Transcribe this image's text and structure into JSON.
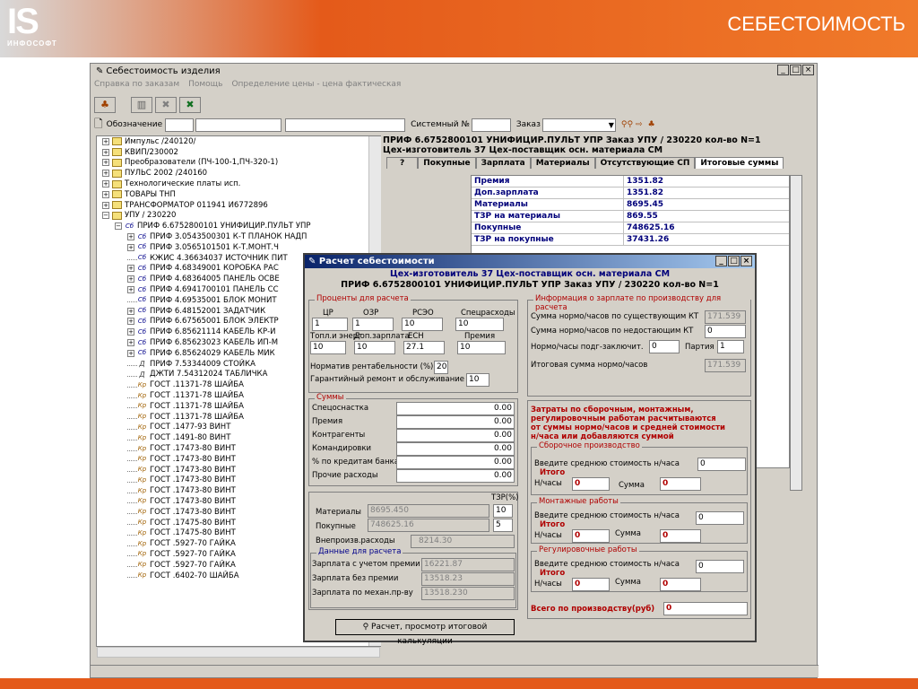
{
  "slide": {
    "logo_big": "IS",
    "logo_small": "ИНФОСОФТ",
    "title": "СЕБЕСТОИМОСТЬ"
  },
  "app": {
    "title": "Себестоимость изделия",
    "menu": [
      "Справка по заказам",
      "Помощь",
      "Определение цены - цена фактическая"
    ],
    "filter": {
      "designation_label": "Обозначение",
      "system_label": "Системный №",
      "order_label": "Заказ"
    }
  },
  "tree": [
    {
      "t": "Импульс /240120/",
      "lv": 1,
      "k": "f"
    },
    {
      "t": "КВИП/230002",
      "lv": 1,
      "k": "f"
    },
    {
      "t": "Преобразователи (ПЧ-100-1,ПЧ-320-1)",
      "lv": 1,
      "k": "f"
    },
    {
      "t": "ПУЛЬС 2002 /240160",
      "lv": 1,
      "k": "f"
    },
    {
      "t": "Технологические платы исп.",
      "lv": 1,
      "k": "f"
    },
    {
      "t": "ТОВАРЫ ТНП",
      "lv": 1,
      "k": "f"
    },
    {
      "t": "ТРАНСФОРМАТОР 011941 И6772896",
      "lv": 1,
      "k": "f"
    },
    {
      "t": "УПУ  / 230220",
      "lv": 1,
      "k": "f",
      "open": true
    },
    {
      "t": "ПРИФ 6.6752800101  УНИФИЦИР.ПУЛЬТ УПР",
      "lv": 2,
      "k": "c",
      "open": true
    },
    {
      "t": "ПРИФ 3.0543500301  К-Т ПЛАНОК НАДП",
      "lv": 3,
      "k": "c"
    },
    {
      "t": "ПРИФ 3.0565101501  К-Т.МОНТ.Ч",
      "lv": 3,
      "k": "c"
    },
    {
      "t": "КЖИС 4.36634037  ИСТОЧНИК ПИТ",
      "lv": 3,
      "k": "c",
      "leaf": true
    },
    {
      "t": "ПРИФ 4.68349001  КОРОБКА РАС",
      "lv": 3,
      "k": "c"
    },
    {
      "t": "ПРИФ 4.68364005  ПАНЕЛЬ ОСВЕ",
      "lv": 3,
      "k": "c"
    },
    {
      "t": "ПРИФ 4.6941700101  ПАНЕЛЬ СС",
      "lv": 3,
      "k": "c"
    },
    {
      "t": "ПРИФ 4.69535001  БЛОК МОНИТ",
      "lv": 3,
      "k": "c",
      "leaf": true
    },
    {
      "t": "ПРИФ 6.48152001  ЗАДАТЧИК",
      "lv": 3,
      "k": "c"
    },
    {
      "t": "ПРИФ 6.67565001  БЛОК ЭЛЕКТР",
      "lv": 3,
      "k": "c"
    },
    {
      "t": "ПРИФ 6.85621114  КАБЕЛЬ КР-И",
      "lv": 3,
      "k": "c"
    },
    {
      "t": "ПРИФ 6.85623023  КАБЕЛЬ ИП-М",
      "lv": 3,
      "k": "c"
    },
    {
      "t": "ПРИФ 6.85624029  КАБЕЛЬ МИК",
      "lv": 3,
      "k": "c"
    },
    {
      "t": "ПРИФ 7.53344009  СТОЙКА",
      "lv": 3,
      "k": "d",
      "leaf": true
    },
    {
      "t": "ДЖТИ 7.54312024  ТАБЛИЧКА",
      "lv": 3,
      "k": "d",
      "leaf": true
    },
    {
      "t": "ГОСТ .11371-78  ШАЙБА",
      "lv": 3,
      "k": "p",
      "leaf": true
    },
    {
      "t": "ГОСТ .11371-78  ШАЙБА",
      "lv": 3,
      "k": "p",
      "leaf": true
    },
    {
      "t": "ГОСТ .11371-78  ШАЙБА",
      "lv": 3,
      "k": "p",
      "leaf": true
    },
    {
      "t": "ГОСТ .11371-78  ШАЙБА",
      "lv": 3,
      "k": "p",
      "leaf": true
    },
    {
      "t": "ГОСТ .1477-93  ВИНТ",
      "lv": 3,
      "k": "p",
      "leaf": true
    },
    {
      "t": "ГОСТ .1491-80  ВИНТ",
      "lv": 3,
      "k": "p",
      "leaf": true
    },
    {
      "t": "ГОСТ .17473-80  ВИНТ",
      "lv": 3,
      "k": "p",
      "leaf": true
    },
    {
      "t": "ГОСТ .17473-80  ВИНТ",
      "lv": 3,
      "k": "p",
      "leaf": true
    },
    {
      "t": "ГОСТ .17473-80  ВИНТ",
      "lv": 3,
      "k": "p",
      "leaf": true
    },
    {
      "t": "ГОСТ .17473-80  ВИНТ",
      "lv": 3,
      "k": "p",
      "leaf": true
    },
    {
      "t": "ГОСТ .17473-80  ВИНТ",
      "lv": 3,
      "k": "p",
      "leaf": true
    },
    {
      "t": "ГОСТ .17473-80  ВИНТ",
      "lv": 3,
      "k": "p",
      "leaf": true
    },
    {
      "t": "ГОСТ .17473-80  ВИНТ",
      "lv": 3,
      "k": "p",
      "leaf": true
    },
    {
      "t": "ГОСТ .17475-80  ВИНТ",
      "lv": 3,
      "k": "p",
      "leaf": true
    },
    {
      "t": "ГОСТ .17475-80  ВИНТ",
      "lv": 3,
      "k": "p",
      "leaf": true
    },
    {
      "t": "ГОСТ .5927-70  ГАЙКА",
      "lv": 3,
      "k": "p",
      "leaf": true
    },
    {
      "t": "ГОСТ .5927-70  ГАЙКА",
      "lv": 3,
      "k": "p",
      "leaf": true
    },
    {
      "t": "ГОСТ .5927-70  ГАЙКА",
      "lv": 3,
      "k": "p",
      "leaf": true
    },
    {
      "t": "ГОСТ .6402-70  ШАЙБА",
      "lv": 3,
      "k": "p",
      "leaf": true
    }
  ],
  "right": {
    "line1": "ПРИФ 6.6752800101  УНИФИЦИР.ПУЛЬТ УПР      Заказ УПУ  / 230220  кол-во N=1",
    "line2": "Цех-изготовитель 37  Цех-поставщик осн. материала СМ",
    "tabs": [
      "?",
      "Покупные",
      "Зарплата",
      "Материалы",
      "Отсутствующие СП",
      "Итоговые суммы"
    ],
    "rows": [
      [
        "Премия",
        "1351.82"
      ],
      [
        "Доп.зарплата",
        "1351.82"
      ],
      [
        "Материалы",
        "8695.45"
      ],
      [
        "ТЗР на материалы",
        "869.55"
      ],
      [
        "Покупные",
        "748625.16"
      ],
      [
        "ТЗР на покупные",
        "37431.26"
      ]
    ]
  },
  "dialog": {
    "title": "Расчет себестоимости",
    "line1": "Цех-изготовитель 37  Цех-поставщик осн. материала СМ",
    "line2": "ПРИФ 6.6752800101  УНИФИЦИР.ПУЛЬТ УПР      Заказ УПУ  / 230220  кол-во N=1",
    "pct": {
      "title": "Проценты для расчета",
      "h1": [
        "ЦР",
        "ОЗР",
        "РСЭО",
        "Спецрасходы"
      ],
      "v1": [
        "1",
        "1",
        "10",
        "10"
      ],
      "h2": [
        "Топл.и энерг",
        "Доп.зарплата",
        "ЕСН",
        "Премия"
      ],
      "v2": [
        "10",
        "10",
        "27.1",
        "10"
      ],
      "rent_label": "Норматив рентабельности (%)",
      "rent": "20",
      "gar_label": "Гарантийный ремонт и обслуживание",
      "gar": "10"
    },
    "sums": {
      "title": "Суммы",
      "rows": [
        [
          "Спецоснастка",
          "0.00"
        ],
        [
          "Премия",
          "0.00"
        ],
        [
          "Контрагенты",
          "0.00"
        ],
        [
          "Командировки",
          "0.00"
        ],
        [
          "% по кредитам банка",
          "0.00"
        ],
        [
          "Прочие расходы",
          "0.00"
        ]
      ]
    },
    "mat": {
      "tzr_label": "ТЗР(%)",
      "rows": [
        [
          "Материалы",
          "8695.450",
          "10"
        ],
        [
          "Покупные",
          "748625.16",
          "5"
        ]
      ],
      "vnepr_label": "Внепроизв.расходы",
      "vnepr": "8214.30"
    },
    "calc": {
      "title": "Данные для расчета",
      "rows": [
        [
          "Зарплата с учетом премии",
          "16221.87"
        ],
        [
          "Зарплата без премии",
          "13518.23"
        ],
        [
          "Зарплата по механ.пр-ву",
          "13518.230"
        ]
      ]
    },
    "info": {
      "title": "Информация о зарплате по производству для расчета",
      "r1": "Сумма нормо/часов  по существующим КТ",
      "v1": "171.539",
      "r2": "Сумма нормо/часов  по недостающим КТ",
      "v2": "0",
      "r3": "Нормо/часы подг-заключит.",
      "v3": "0",
      "party_label": "Партия",
      "party": "1",
      "r4": "Итоговая сумма нормо/часов",
      "v4": "171.539"
    },
    "costs_text": [
      "Затраты  по сборочным, монтажным,",
      "регулировочным работам  расчитываются",
      " от суммы нормо/часов  и средней стоимости",
      "н/часа или добавляются суммой"
    ],
    "asm": {
      "title": "Сборочное производство",
      "itogo": "Итого",
      "label": "Введите среднюю стоимость н/часа",
      "v": "0",
      "nh_label": "Н/часы",
      "nh": "0",
      "sum_label": "Сумма",
      "sum": "0"
    },
    "mnt": {
      "title": "Монтажные работы",
      "itogo": "Итого",
      "label": "Введите среднюю стоимость н/часа",
      "v": "0",
      "nh_label": "Н/часы",
      "nh": "0",
      "sum_label": "Сумма",
      "sum": "0"
    },
    "reg": {
      "title": "Регулировочные работы",
      "itogo": "Итого",
      "label": "Введите среднюю стоимость н/часа",
      "v": "0",
      "nh_label": "Н/часы",
      "nh": "0",
      "sum_label": "Сумма",
      "sum": "0"
    },
    "total_label": "Всего по производству(руб)",
    "total": "0",
    "calc_button": "Расчет, просмотр итоговой калькуляции"
  }
}
